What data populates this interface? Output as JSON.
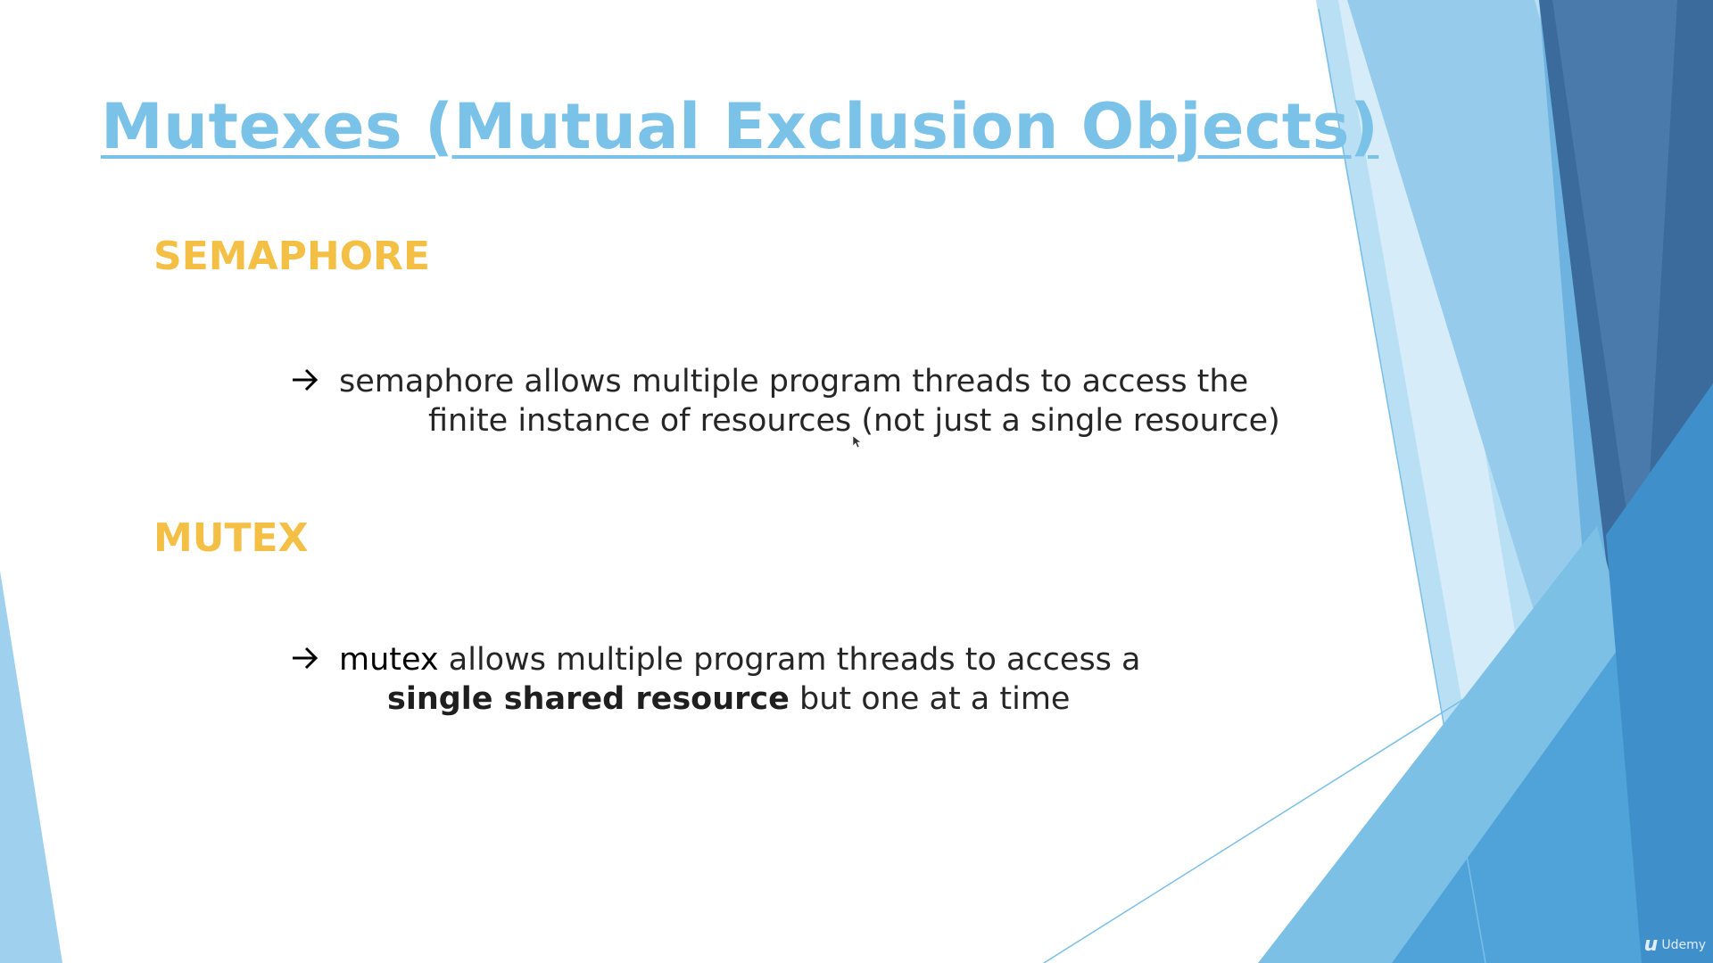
{
  "slide": {
    "title": "Mutexes (Mutual Exclusion Objects)",
    "sections": [
      {
        "heading": "SEMAPHORE",
        "bullet_line1": "semaphore allows multiple program threads to access the",
        "bullet_line2": "finite instance of resources (not just a single resource)"
      },
      {
        "heading": "MUTEX",
        "bullet_term": "mutex",
        "bullet_line1_rest": " allows multiple program threads to access a",
        "bullet_line2_bold": "single shared resource",
        "bullet_line2_rest": " but one at a time"
      }
    ],
    "watermark": "Udemy",
    "watermark_logo": "u"
  },
  "colors": {
    "title": "#7bc2e8",
    "heading": "#f3bf45",
    "body_text": "#262626",
    "accent_light_blue": "#9fd1ef",
    "accent_mid_blue": "#5aaede",
    "accent_dark_blue": "#3b6b9c"
  },
  "icons": [
    "right-arrow-icon",
    "mouse-cursor-icon",
    "udemy-logo-icon"
  ]
}
